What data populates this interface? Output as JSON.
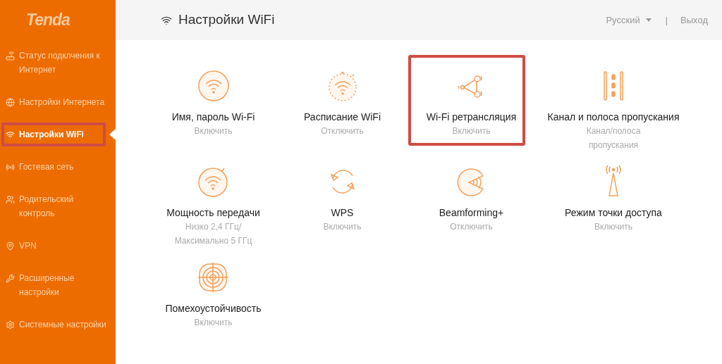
{
  "logo": "Tenda",
  "sidebar": {
    "items": [
      {
        "kind": "router",
        "label": "Статус подклчения к Интернет",
        "selected": false,
        "highlighted": false
      },
      {
        "kind": "globe",
        "label": "Настройки Интернета",
        "selected": false,
        "highlighted": false
      },
      {
        "kind": "wifi",
        "label": "Настройки WiFi",
        "selected": true,
        "highlighted": true
      },
      {
        "kind": "guest",
        "label": "Гостевая сеть",
        "selected": false,
        "highlighted": false
      },
      {
        "kind": "parental",
        "label": "Родительский контроль",
        "selected": false,
        "highlighted": false
      },
      {
        "kind": "vpn",
        "label": "VPN",
        "selected": false,
        "highlighted": false
      },
      {
        "kind": "wrench",
        "label": "Расширенные настройки",
        "selected": false,
        "highlighted": false
      },
      {
        "kind": "gear",
        "label": "Системные настройки",
        "selected": false,
        "highlighted": false
      }
    ]
  },
  "header": {
    "title": "Настройки WiFi",
    "language": "Русский",
    "separator": "|",
    "logout": "Выход"
  },
  "tiles": [
    {
      "kind": "wifi",
      "title": "Имя, пароль Wi-Fi",
      "status": [
        "Включить"
      ],
      "highlighted": false
    },
    {
      "kind": "schedule",
      "title": "Расписание WiFi",
      "status": [
        "Отключить"
      ],
      "highlighted": false
    },
    {
      "kind": "relay",
      "title": "Wi-Fi ретрансляция",
      "status": [
        "Включить"
      ],
      "highlighted": true
    },
    {
      "kind": "channel",
      "title": "Канал и полоса пропускания",
      "status": [
        "Канал/полоса",
        "пропускания"
      ],
      "highlighted": false
    },
    {
      "kind": "power",
      "title": "Мощность передачи",
      "status": [
        "Низко 2,4 ГГц/",
        "Максимально 5 ГГц"
      ],
      "highlighted": false
    },
    {
      "kind": "wps",
      "title": "WPS",
      "status": [
        "Включить"
      ],
      "highlighted": false
    },
    {
      "kind": "beam",
      "title": "Beamforming+",
      "status": [
        "Отключить"
      ],
      "highlighted": false
    },
    {
      "kind": "antenna",
      "title": "Режим точки доступа",
      "status": [
        "Включить"
      ],
      "highlighted": false
    },
    {
      "kind": "target",
      "title": "Помехоустойчивость",
      "status": [
        "Включить"
      ],
      "highlighted": false
    }
  ]
}
